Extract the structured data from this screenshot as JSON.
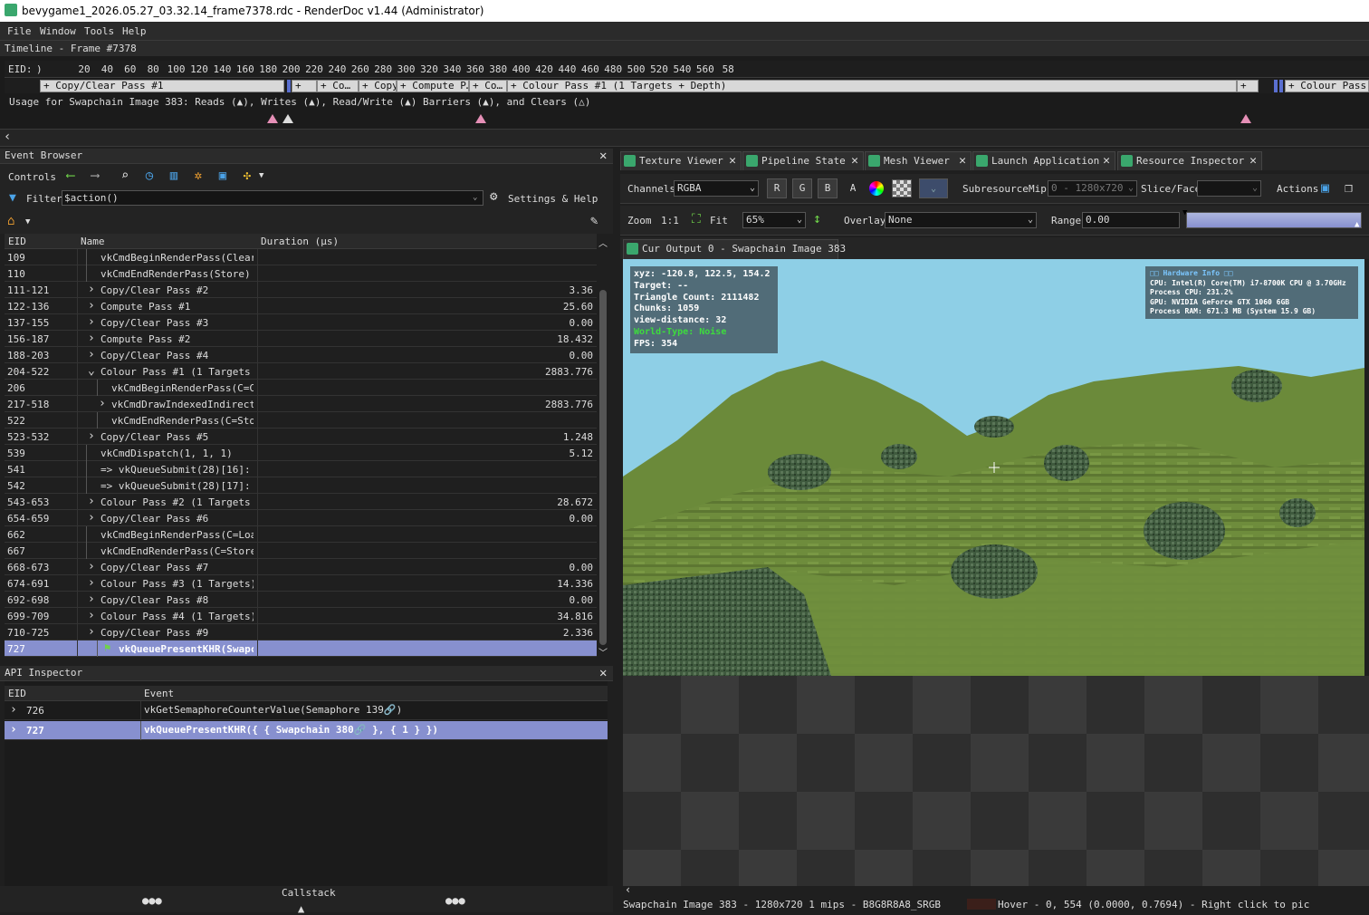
{
  "window": {
    "title": "bevygame1_2026.05.27_03.32.14_frame7378.rdc - RenderDoc v1.44 (Administrator)"
  },
  "menu": [
    "File",
    "Window",
    "Tools",
    "Help"
  ],
  "timeline": {
    "header": "Timeline - Frame #7378",
    "eid_label": "EID:",
    "eid_start": ")",
    "ticks": [
      "20",
      "40",
      "60",
      "80",
      "100",
      "120",
      "140",
      "160",
      "180",
      "200",
      "220",
      "240",
      "260",
      "280",
      "300",
      "320",
      "340",
      "360",
      "380",
      "400",
      "420",
      "440",
      "460",
      "480",
      "500",
      "520",
      "540",
      "560",
      "58"
    ],
    "passes": [
      "+ Copy/Clear Pass #1",
      "+",
      "+ Co…",
      "+ Copy…",
      "+ Compute P…",
      "+ Co…",
      "+ Colour Pass #1 (1 Targets + Depth)",
      "+",
      "+ Colour Pass #2"
    ],
    "usage": "Usage for Swapchain Image 383: Reads (▲), Writes (▲), Read/Write (▲) Barriers (▲), and Clears (△)"
  },
  "event_browser": {
    "title": "Event Browser",
    "controls_label": "Controls",
    "filter_label": "Filter",
    "filter_value": "$action()",
    "settings_label": "Settings & Help",
    "columns": [
      "EID",
      "Name",
      "Duration (µs)"
    ],
    "rows": [
      {
        "eid": "109",
        "name": "vkCmdBeginRenderPass(Clear)",
        "dur": "",
        "indent": 1,
        "exp": ""
      },
      {
        "eid": "110",
        "name": "vkCmdEndRenderPass(Store)",
        "dur": "",
        "indent": 1,
        "exp": ""
      },
      {
        "eid": "111-121",
        "name": "Copy/Clear Pass #2",
        "dur": "3.36",
        "indent": 1,
        "exp": "›"
      },
      {
        "eid": "122-136",
        "name": "Compute Pass #1",
        "dur": "25.60",
        "indent": 1,
        "exp": "›"
      },
      {
        "eid": "137-155",
        "name": "Copy/Clear Pass #3",
        "dur": "0.00",
        "indent": 1,
        "exp": "›"
      },
      {
        "eid": "156-187",
        "name": "Compute Pass #2",
        "dur": "18.432",
        "indent": 1,
        "exp": "›"
      },
      {
        "eid": "188-203",
        "name": "Copy/Clear Pass #4",
        "dur": "0.00",
        "indent": 1,
        "exp": "›"
      },
      {
        "eid": "204-522",
        "name": "Colour Pass #1 (1 Targets …",
        "dur": "2883.776",
        "indent": 1,
        "exp": "⌄"
      },
      {
        "eid": "206",
        "name": "vkCmdBeginRenderPass(C=C…",
        "dur": "",
        "indent": 2,
        "exp": ""
      },
      {
        "eid": "217-518",
        "name": "vkCmdDrawIndexedIndirect…",
        "dur": "2883.776",
        "indent": 2,
        "exp": "›"
      },
      {
        "eid": "522",
        "name": "vkCmdEndRenderPass(C=Sto…",
        "dur": "",
        "indent": 2,
        "exp": ""
      },
      {
        "eid": "523-532",
        "name": "Copy/Clear Pass #5",
        "dur": "1.248",
        "indent": 1,
        "exp": "›"
      },
      {
        "eid": "539",
        "name": "vkCmdDispatch(1, 1, 1)",
        "dur": "5.12",
        "indent": 1,
        "exp": ""
      },
      {
        "eid": "541",
        "name": "=>  vkQueueSubmit(28)[16]:  v",
        "dur": "",
        "indent": 1,
        "exp": ""
      },
      {
        "eid": "542",
        "name": "=>  vkQueueSubmit(28)[17]:  v",
        "dur": "",
        "indent": 1,
        "exp": ""
      },
      {
        "eid": "543-653",
        "name": "Colour Pass #2 (1 Targets …",
        "dur": "28.672",
        "indent": 1,
        "exp": "›"
      },
      {
        "eid": "654-659",
        "name": "Copy/Clear Pass #6",
        "dur": "0.00",
        "indent": 1,
        "exp": "›"
      },
      {
        "eid": "662",
        "name": "vkCmdBeginRenderPass(C=Loa…",
        "dur": "",
        "indent": 1,
        "exp": ""
      },
      {
        "eid": "667",
        "name": "vkCmdEndRenderPass(C=Store…",
        "dur": "",
        "indent": 1,
        "exp": ""
      },
      {
        "eid": "668-673",
        "name": "Copy/Clear Pass #7",
        "dur": "0.00",
        "indent": 1,
        "exp": "›"
      },
      {
        "eid": "674-691",
        "name": "Colour Pass #3 (1 Targets)",
        "dur": "14.336",
        "indent": 1,
        "exp": "›"
      },
      {
        "eid": "692-698",
        "name": "Copy/Clear Pass #8",
        "dur": "0.00",
        "indent": 1,
        "exp": "›"
      },
      {
        "eid": "699-709",
        "name": "Colour Pass #4 (1 Targets)",
        "dur": "34.816",
        "indent": 1,
        "exp": "›"
      },
      {
        "eid": "710-725",
        "name": "Copy/Clear Pass #9",
        "dur": "2.336",
        "indent": 1,
        "exp": "›"
      },
      {
        "eid": "727",
        "name": "vkQueuePresentKHR(Swapch",
        "dur": "",
        "indent": 2,
        "exp": "",
        "selected": true
      }
    ]
  },
  "api_inspector": {
    "title": "API Inspector",
    "columns": [
      "EID",
      "Event"
    ],
    "rows": [
      {
        "eid": "726",
        "event": "vkGetSemaphoreCounterValue(Semaphore 139🔗)"
      },
      {
        "eid": "727",
        "event": "vkQueuePresentKHR({  {  Swapchain 380🔗  },  {  1  }  })",
        "selected": true
      }
    ],
    "callstack_label": "Callstack"
  },
  "tabs": [
    "Texture Viewer",
    "Pipeline State",
    "Mesh Viewer",
    "Launch Application",
    "Resource Inspector"
  ],
  "texture_viewer": {
    "channels_label": "Channels",
    "channels_value": "RGBA",
    "channel_buttons": [
      "R",
      "G",
      "B",
      "A"
    ],
    "subresource_label": "Subresource",
    "mip_label": "Mip",
    "mip_value": "0 - 1280x720",
    "slice_label": "Slice/Face",
    "actions_label": "Actions",
    "zoom_label": "Zoom",
    "zoom_1to1": "1:1",
    "fit_label": "Fit",
    "zoom_value": "65%",
    "overlay_label": "Overlay",
    "overlay_value": "None",
    "range_label": "Range",
    "range_value": "0.00",
    "output_tab": "Cur Output 0 - Swapchain Image 383"
  },
  "game_overlay": {
    "left_lines": [
      "xyz: -120.8, 122.5, 154.2",
      "Target: --",
      "Triangle Count: 2111482",
      "Chunks: 1059",
      "view-distance: 32",
      "World-Type: Noise",
      "FPS: 354"
    ],
    "world_type_color": "#3ddc3d",
    "right_lines": [
      "□□ Hardware Info □□",
      "CPU: Intel(R) Core(TM) i7-8700K CPU @ 3.70GHz",
      "Process CPU: 231.2%",
      "GPU: NVIDIA GeForce GTX 1060 6GB",
      "Process RAM: 671.3 MB (System 15.9 GB)"
    ],
    "hardware_title_color": "#7cc7ff"
  },
  "status": {
    "text": "Swapchain Image 383 - 1280x720 1 mips - B8G8R8A8_SRGB",
    "hover": "Hover -      0,  554 (0.0000, 0.7694) - Right click to pic"
  },
  "colors": {
    "accent_green": "#3aa76d",
    "selection": "#8790cf",
    "sky": "#8ecfe6",
    "grass": "#6b8a3a"
  }
}
